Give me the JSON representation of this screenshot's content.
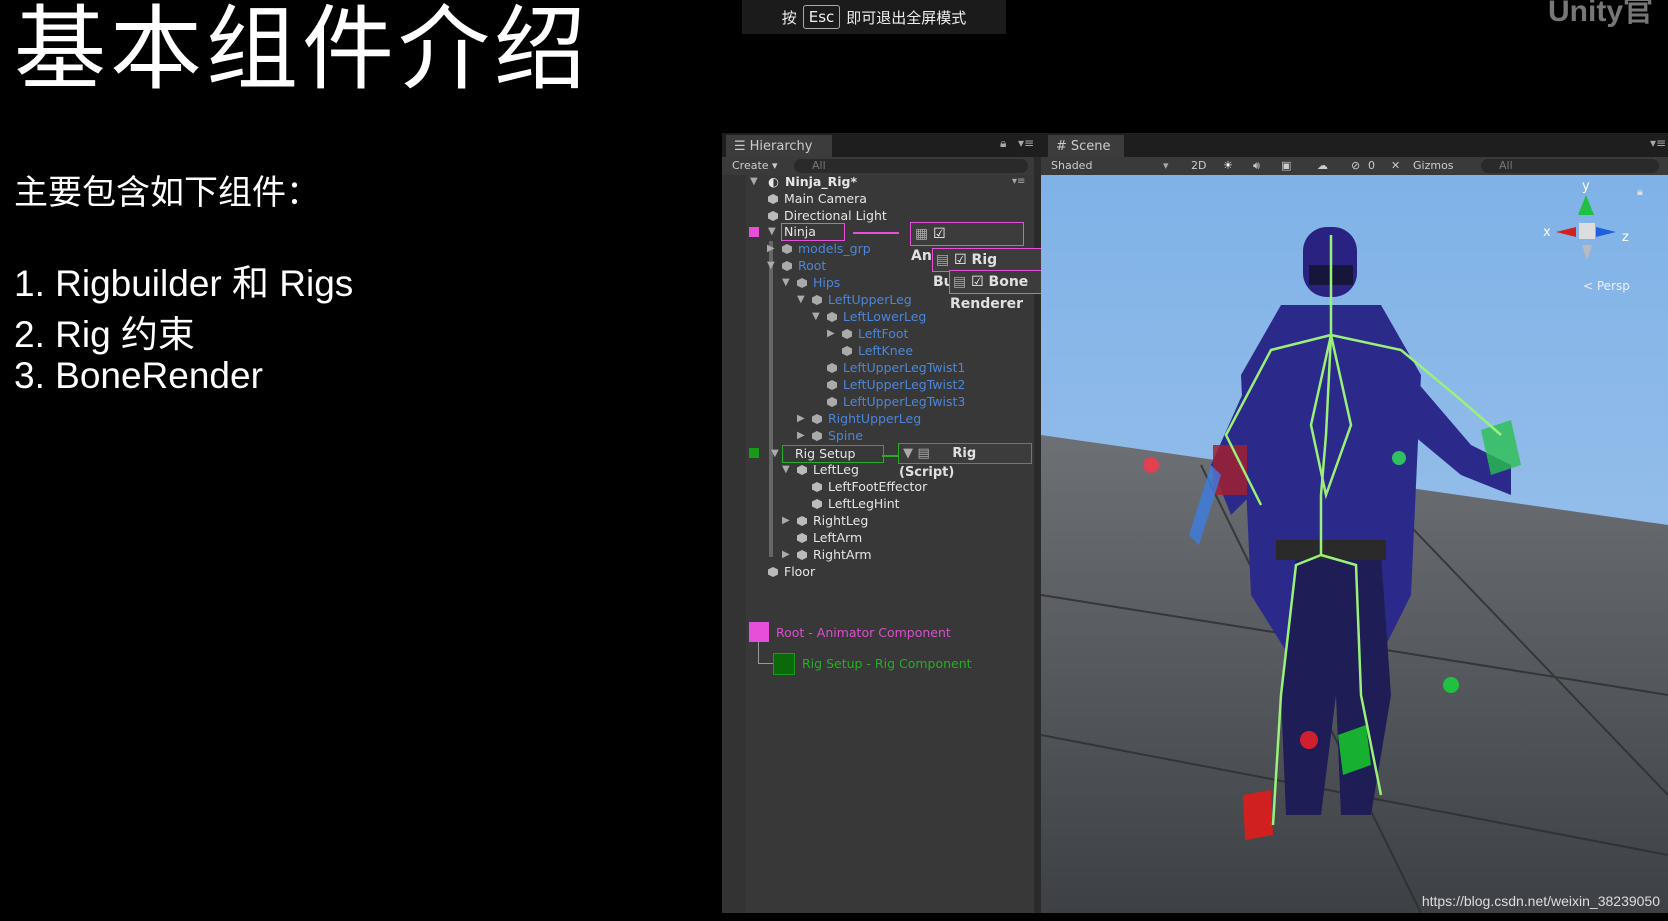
{
  "slide": {
    "title": "基本组件介绍",
    "subtitle": "主要包含如下组件：",
    "items": [
      "1. Rigbuilder 和 Rigs",
      "2. Rig 约束",
      "3. BoneRender"
    ]
  },
  "banner": {
    "prefix": "按",
    "key": "Esc",
    "suffix": "即可退出全屏模式"
  },
  "logo": "Unity官",
  "hierarchy": {
    "tab": "Hierarchy",
    "create": "Create ▾",
    "search_placeholder": "All",
    "scene_root": "Ninja_Rig*",
    "rows": [
      {
        "label": "Main Camera"
      },
      {
        "label": "Directional Light"
      },
      {
        "label": "Ninja"
      },
      {
        "label": "models_grp"
      },
      {
        "label": "Root"
      },
      {
        "label": "Hips"
      },
      {
        "label": "LeftUpperLeg"
      },
      {
        "label": "LeftLowerLeg"
      },
      {
        "label": "LeftFoot"
      },
      {
        "label": "LeftKnee"
      },
      {
        "label": "LeftUpperLegTwist1"
      },
      {
        "label": "LeftUpperLegTwist2"
      },
      {
        "label": "LeftUpperLegTwist3"
      },
      {
        "label": "RightUpperLeg"
      },
      {
        "label": "Spine"
      },
      {
        "label": "Rig Setup"
      },
      {
        "label": "LeftLeg"
      },
      {
        "label": "LeftFootEffector"
      },
      {
        "label": "LeftLegHint"
      },
      {
        "label": "RightLeg"
      },
      {
        "label": "LeftArm"
      },
      {
        "label": "RightArm"
      },
      {
        "label": "Floor"
      }
    ],
    "components": {
      "animator": "Animator",
      "rig_builder": "Rig Builder",
      "bone_renderer": "Bone Renderer",
      "rig_script": "Rig (Script)"
    },
    "legend": {
      "pink": "Root - Animator Component",
      "green": "Rig Setup - Rig Component"
    },
    "colors": {
      "pink": "#e84fd8",
      "green": "#22b022",
      "blue_prefab": "#4d86d6"
    }
  },
  "scene": {
    "tab": "Scene",
    "shading": "Shaded",
    "mode_2d": "2D",
    "hidden_count": "0",
    "gizmos": "Gizmos",
    "search_placeholder": "All",
    "projection": "< Persp",
    "axis_y": "y",
    "axis_x": "x",
    "axis_z": "z"
  },
  "watermark": "https://blog.csdn.net/weixin_38239050"
}
